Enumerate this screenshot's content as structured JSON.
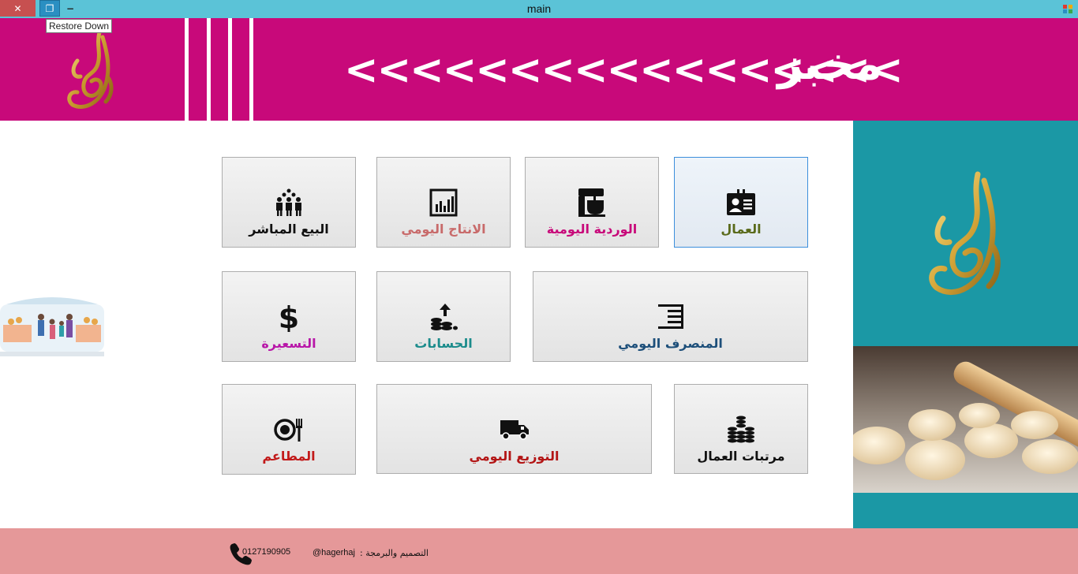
{
  "window": {
    "title": "main",
    "close_glyph": "✕",
    "restore_glyph": "❐",
    "minimize_glyph": "−",
    "tooltip": "Restore Down"
  },
  "header": {
    "title": "مخبز",
    "arrows": "<<<<<<<<<<<<<<<<<",
    "background": "#c8097a"
  },
  "tiles": {
    "workers": {
      "label": "العمال",
      "icon": "id-badge-icon",
      "color": "#5a6a1a"
    },
    "daily_shift": {
      "label": "الوردية اليومية",
      "icon": "mixer-icon",
      "color": "#c8097a"
    },
    "daily_production": {
      "label": "الانتاج اليومي",
      "icon": "bar-chart-icon",
      "color": "#c86a6a"
    },
    "direct_sale": {
      "label": "البيع المباشر",
      "icon": "group-icon",
      "color": "#111111"
    },
    "daily_expense": {
      "label": "المنصرف اليومي",
      "icon": "align-right-icon",
      "color": "#1d4f7a"
    },
    "accounts": {
      "label": "الحسابات",
      "icon": "coins-up-icon",
      "color": "#1c8c8c"
    },
    "pricing": {
      "label": "التسعيرة",
      "icon": "dollar-icon",
      "color": "#b816a8"
    },
    "worker_salaries": {
      "label": "مرتبات العمال",
      "icon": "coin-stacks-icon",
      "color": "#111111"
    },
    "daily_distribution": {
      "label": "التوزيع اليومي",
      "icon": "truck-icon",
      "color": "#b31515"
    },
    "restaurants": {
      "label": "المطاعم",
      "icon": "plate-fork-icon",
      "color": "#c21a1a"
    }
  },
  "footer": {
    "phone": "0127190905",
    "handle": "@hagerhaj",
    "credit_label": "التصميم والبرمجة :",
    "background": "#e59899"
  },
  "side_panel": {
    "background": "#1b98a5"
  }
}
